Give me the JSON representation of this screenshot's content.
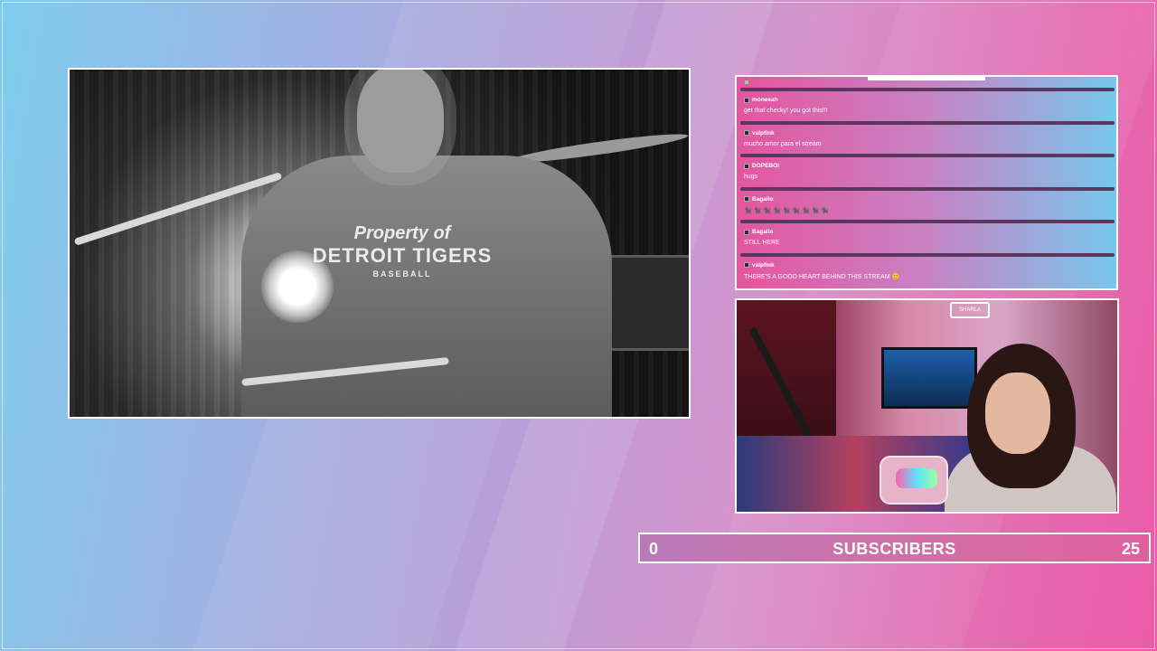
{
  "colors": {
    "gradient_left": "#7fcdee",
    "gradient_right": "#ec5aa8",
    "frame_border": "#ffffff",
    "chat_bar": "#5b3760"
  },
  "video": {
    "shirt_line1": "Property of",
    "shirt_line2": "DETROIT TIGERS",
    "shirt_line3": "BASEBALL"
  },
  "chat": {
    "messages": [
      {
        "user": "moneeah",
        "text": "get that checky! you got this!!!"
      },
      {
        "user": "valpfink",
        "text": "mucho amor para el stream"
      },
      {
        "user": "DOPEBOI",
        "text": "hugs"
      },
      {
        "user": "Bagallo",
        "text": "🐈‍⬛ 🐈‍⬛ 🐈‍⬛ 🐈‍⬛ 🐈‍⬛ 🐈‍⬛ 🐈‍⬛ 🐈‍⬛ 🐈‍⬛"
      },
      {
        "user": "Bagallo",
        "text": "STILL HERE"
      },
      {
        "user": "valpfink",
        "text": "THERE'S A GOOD HEART BEHIND THIS STREAM 😊"
      }
    ]
  },
  "webcam": {
    "sign_text": "SHARLA"
  },
  "subscribers": {
    "current": "0",
    "label": "SUBSCRIBERS",
    "goal": "25",
    "progress": 0
  }
}
